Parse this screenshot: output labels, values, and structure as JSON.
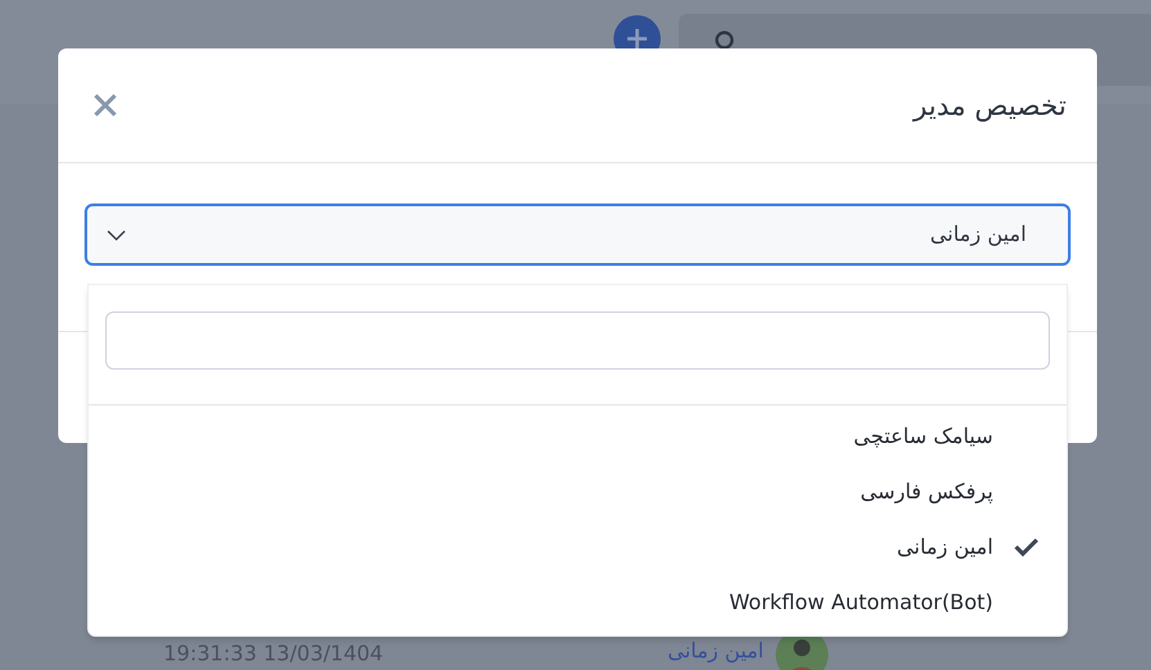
{
  "background": {
    "row": {
      "time": "19:31:33 13/03/1404",
      "user": "امین زمانی"
    }
  },
  "dialog": {
    "title": "تخصیص مدیر",
    "select": {
      "value": "امین زمانی",
      "expanded": true
    },
    "dropdown": {
      "options": [
        {
          "label": "سیامک ساعتچی",
          "selected": false
        },
        {
          "label": "پرفکس فارسی",
          "selected": false
        },
        {
          "label": "امین زمانی",
          "selected": true
        },
        {
          "label": "Workflow Automator(Bot)",
          "selected": false
        }
      ]
    }
  }
}
